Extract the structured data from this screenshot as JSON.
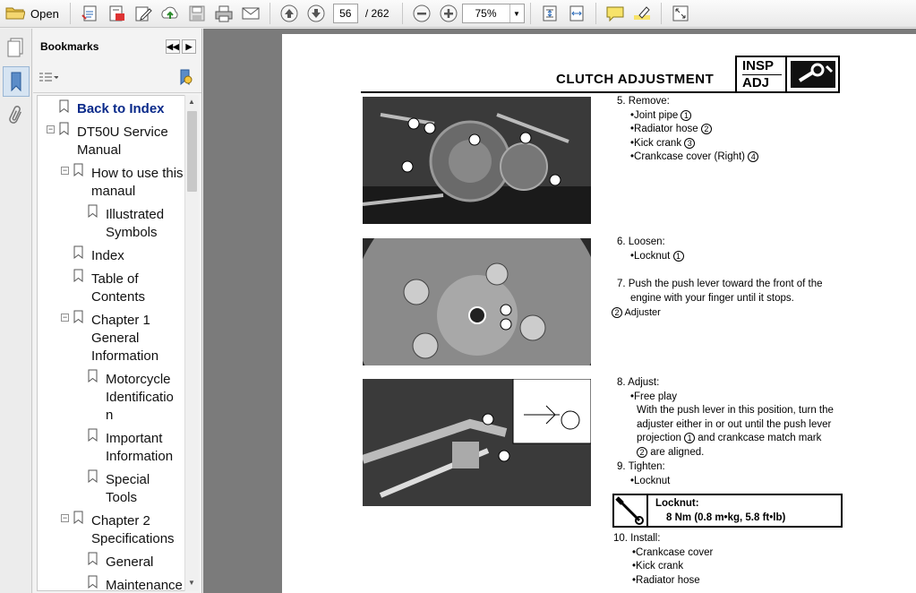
{
  "toolbar": {
    "open_label": "Open",
    "page_current": "56",
    "page_total": "/ 262",
    "zoom": "75%"
  },
  "bookmarks": {
    "title": "Bookmarks",
    "items": [
      {
        "label": "Back to Index",
        "line2": ""
      },
      {
        "label": "DT50U Service",
        "line2": "Manual"
      },
      {
        "label": "How to use this",
        "line2": "manaul"
      },
      {
        "label": "Illustrated",
        "line2": "Symbols"
      },
      {
        "label": "Index",
        "line2": ""
      },
      {
        "label": "Table of",
        "line2": "Contents"
      },
      {
        "label": "Chapter 1",
        "line2": "General",
        "line3": "Information"
      },
      {
        "label": "Motorcycle",
        "line2": "Identificatio",
        "line3": "n"
      },
      {
        "label": "Important",
        "line2": "Information"
      },
      {
        "label": "Special",
        "line2": "Tools"
      },
      {
        "label": "Chapter 2",
        "line2": "Specifications"
      },
      {
        "label": "General",
        "line2": ""
      },
      {
        "label": "Maintenance",
        "line2": ""
      }
    ]
  },
  "document": {
    "title": "CLUTCH ADJUSTMENT",
    "badge_top": "INSP",
    "badge_bottom": "ADJ",
    "step5": {
      "head": "5. Remove:",
      "items": [
        "•Joint pipe",
        "•Radiator hose",
        "•Kick crank",
        "•Crankcase cover (Right)"
      ],
      "nums": [
        "1",
        "2",
        "3",
        "4"
      ]
    },
    "step6": {
      "head": "6. Loosen:",
      "item": "•Locknut",
      "num": "1"
    },
    "step7": {
      "line1": "7. Push the push lever toward the front of the",
      "line2": "engine with your finger until it stops.",
      "note": "Adjuster",
      "note_num": "2"
    },
    "step8": {
      "head": "8. Adjust:",
      "item": "•Free play",
      "lines": [
        "With the push lever in this position, turn the",
        "adjuster either in or out until the push lever",
        "projection",
        "and crankcase match mark",
        "are aligned."
      ]
    },
    "step9": {
      "head": "9. Tighten:",
      "item": "•Locknut"
    },
    "spec": {
      "label": "Locknut:",
      "value": "8 Nm (0.8 m•kg, 5.8 ft•lb)"
    },
    "step10": {
      "head": "10. Install:",
      "items": [
        "•Crankcase cover",
        "•Kick crank",
        "•Radiator hose"
      ]
    }
  }
}
